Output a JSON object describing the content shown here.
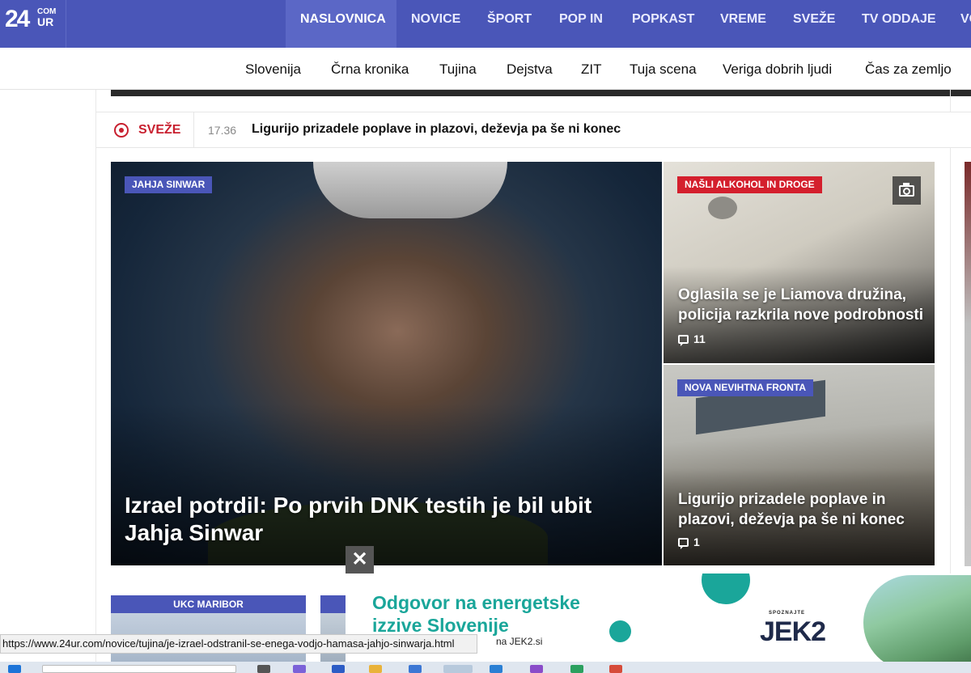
{
  "logo": {
    "big": "24",
    "com": "COM",
    "ur": "UR"
  },
  "nav": {
    "items": [
      "NASLOVNICA",
      "NOVICE",
      "ŠPORT",
      "POP IN",
      "POPKAST",
      "VREME",
      "SVEŽE",
      "TV ODDAJE",
      "VO"
    ],
    "active": "NASLOVNICA"
  },
  "subnav": {
    "items": [
      "Slovenija",
      "Črna kronika",
      "Tujina",
      "Dejstva",
      "ZIT",
      "Tuja scena",
      "Veriga dobrih ljudi",
      "Čas za zemljo"
    ]
  },
  "breaking": {
    "label": "SVEŽE",
    "time": "17.36",
    "text": "Ligurijo prizadele poplave in plazovi, deževja pa še ni konec"
  },
  "main_story": {
    "tag": "JAHJA SINWAR",
    "title": "Izrael potrdil: Po prvih DNK testih je bil ubit Jahja Sinwar"
  },
  "side_stories": [
    {
      "tag": "NAŠLI ALKOHOL IN DROGE",
      "tag_color": "#d41f2d",
      "title": "Oglasila se je Liamova družina, policija razkrila nove podrobnosti",
      "comments": "11",
      "gallery": true
    },
    {
      "tag": "NOVA NEVIHTNA FRONTA",
      "tag_color": "#4a56b8",
      "title": "Ligurijo prizadele poplave in plazovi, deževja pa še ni konec",
      "comments": "1",
      "gallery": false
    }
  ],
  "lower_cards": [
    {
      "tag": "UKC MARIBOR"
    },
    {
      "tag": ""
    }
  ],
  "ad": {
    "title": "Odgovor na energetske izzive Slovenije",
    "sub": "na JEK2.si",
    "kicker": "SPOZNAJTE",
    "brand": "JEK2",
    "close": "✕"
  },
  "statusbar": {
    "url": "https://www.24ur.com/novice/tujina/je-izrael-odstranil-se-enega-vodjo-hamasa-jahjo-sinwarja.html"
  },
  "colors": {
    "brand": "#4a56b8",
    "alert": "#d41f2d",
    "ad_accent": "#1aa69a"
  }
}
